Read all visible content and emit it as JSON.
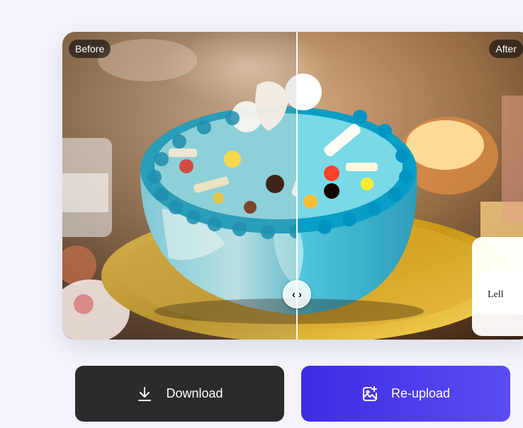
{
  "comparison": {
    "before_label": "Before",
    "after_label": "After",
    "handle_left": "‹",
    "handle_right": "›"
  },
  "actions": {
    "download_label": "Download",
    "download_icon": "download-icon",
    "reupload_label": "Re-upload",
    "reupload_icon": "image-plus-icon"
  },
  "colors": {
    "download_bg": "#2b2b2d",
    "reupload_bg_start": "#3d2ce6",
    "reupload_bg_end": "#5a4df2",
    "page_bg": "#f3f4fb"
  }
}
